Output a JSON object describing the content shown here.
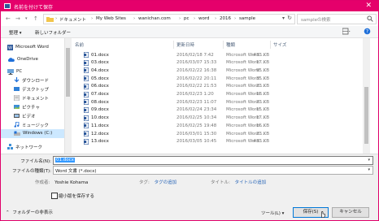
{
  "window": {
    "title": "名前を付けて保存",
    "accent_color": "#e5006b",
    "close_glyph": "✕"
  },
  "nav": {
    "back": "←",
    "forward": "→",
    "up": "↑",
    "breadcrumbs": [
      "ドキュメント",
      "My Web Sites",
      "wanichan.com",
      "pc",
      "word",
      "2016",
      "sample"
    ],
    "separator": "›",
    "search_placeholder": "sampleの検索"
  },
  "toolbar": {
    "organize": "整理 ▾",
    "new_folder": "新しいフォルダー"
  },
  "sidebar": [
    {
      "label": "Microsoft Word",
      "icon": "word-icon"
    },
    {
      "label": "OneDrive",
      "icon": "cloud-icon"
    },
    {
      "label": "PC",
      "icon": "pc-icon"
    },
    {
      "label": "ダウンロード",
      "icon": "download-icon"
    },
    {
      "label": "デスクトップ",
      "icon": "desktop-icon"
    },
    {
      "label": "ドキュメント",
      "icon": "documents-icon"
    },
    {
      "label": "ピクチャ",
      "icon": "pictures-icon"
    },
    {
      "label": "ビデオ",
      "icon": "video-icon"
    },
    {
      "label": "ミュージック",
      "icon": "music-icon"
    },
    {
      "label": "Windows (C:)",
      "icon": "drive-icon"
    },
    {
      "label": "ネットワーク",
      "icon": "network-icon"
    }
  ],
  "columns": {
    "name": "名前",
    "date": "更新日時",
    "type": "種類",
    "size": "サイズ"
  },
  "files": [
    {
      "name": "01.docx",
      "date": "2016/02/18 7:42",
      "type": "Microsoft Word ...",
      "size": "433 KB"
    },
    {
      "name": "03.docx",
      "date": "2016/03/07 15:33",
      "type": "Microsoft Word ...",
      "size": "17 KB"
    },
    {
      "name": "04.docx",
      "date": "2016/02/22 16:38",
      "type": "Microsoft Word ...",
      "size": "95 KB"
    },
    {
      "name": "05.docx",
      "date": "2016/02/22 20:11",
      "type": "Microsoft Word ...",
      "size": "35 KB"
    },
    {
      "name": "06.docx",
      "date": "2016/02/22 21:53",
      "type": "Microsoft Word ...",
      "size": "23 KB"
    },
    {
      "name": "07.docx",
      "date": "2016/02/23 1:20",
      "type": "Microsoft Word ...",
      "size": "18 KB"
    },
    {
      "name": "08.docx",
      "date": "2016/02/23 11:07",
      "type": "Microsoft Word ...",
      "size": "23 KB"
    },
    {
      "name": "09.docx",
      "date": "2016/02/24 23:34",
      "type": "Microsoft Word ...",
      "size": "15 KB"
    },
    {
      "name": "10.docx",
      "date": "2016/02/25 10:34",
      "type": "Microsoft Word ...",
      "size": "17 KB"
    },
    {
      "name": "11.docx",
      "date": "2016/02/25 19:48",
      "type": "Microsoft Word ...",
      "size": "16 KB"
    },
    {
      "name": "12.docx",
      "date": "2016/03/01 15:30",
      "type": "Microsoft Word ...",
      "size": "23 KB"
    },
    {
      "name": "13.docx",
      "date": "2016/03/05 10:45",
      "type": "Microsoft Word ...",
      "size": "433 KB"
    }
  ],
  "form": {
    "filename_label": "ファイル名(N):",
    "filename_value": "01.docx",
    "filetype_label": "ファイルの種類(T):",
    "filetype_value": "Word 文書 (*.docx)",
    "author_label": "作成者:",
    "author_value": "Yoshie Kohama",
    "tags_label": "タグ:",
    "tags_value": "タグの追加",
    "title_label": "タイトル:",
    "title_value": "タイトルの追加",
    "thumbnail_label": "縮小版を保存する",
    "hide_folders": "フォルダーの非表示",
    "tools": "ツール(L)",
    "save": "保存(S)",
    "cancel": "キャンセル"
  }
}
